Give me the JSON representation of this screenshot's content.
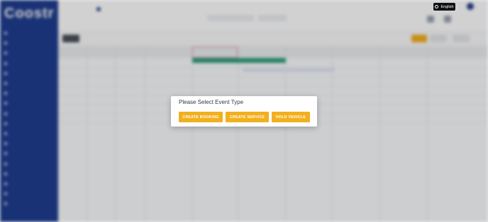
{
  "language": {
    "label": "English",
    "icon": "globe-icon"
  },
  "modal": {
    "title": "Please Select Event Type",
    "buttons": [
      "CREATE BOOKING",
      "CREATE SERVICE",
      "HOLD VEHICLE"
    ]
  },
  "colors": {
    "accent": "#f2b01e",
    "sidebar": "#1f3d8f",
    "event": "#2e9e7b"
  }
}
